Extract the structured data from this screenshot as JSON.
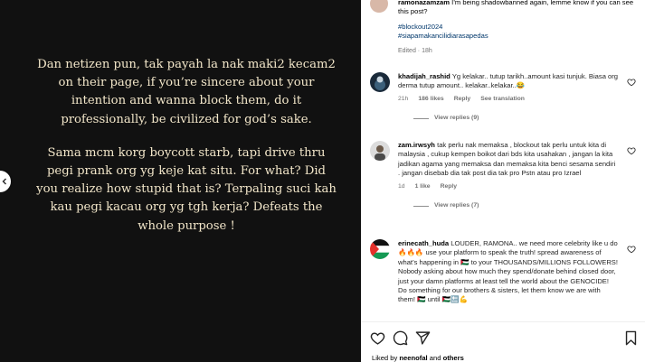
{
  "story": {
    "paragraph1": "Dan netizen pun, tak payah la nak maki2 kecam2 on their page, if you’re sincere about your intention and wanna block them, do it professionally, be civilized for god’s sake.",
    "paragraph2": "Sama mcm korg boycott starb, tapi drive thru pegi prank org yg keje kat situ. For what? Did you realize how stupid that is? Terpaling suci kah kau pegi kacau org yg tgh kerja? Defeats the whole purpose !"
  },
  "caption": {
    "username": "ramonazamzam",
    "text": "I’m being shadowbanned again, lemme know if you can see this post?",
    "hashtags": [
      "#blockout2024",
      "#siapamakancilidiarasapedas"
    ],
    "edited": "Edited · 18h"
  },
  "comments": [
    {
      "username": "khadijah_rashid",
      "text": "Yg kelakar.. tutup tarikh..amount kasi tunjuk. Biasa org derma tutup amount.. kelakar..kelakar..😂",
      "time": "21h",
      "likes": "186 likes",
      "reply": "Reply",
      "translation": "See translation",
      "view_replies": "View replies (9)"
    },
    {
      "username": "zam.irwsyh",
      "text": "tak perlu nak memaksa , blockout tak perlu untuk kita di malaysia , cukup kempen boikot dari bds kita usahakan , jangan la kita jadikan agama yang memaksa dan memaksa kita benci sesama sendiri . jangan disebab dia tak post dia tak pro Pstn atau pro Izrael",
      "time": "1d",
      "likes": "1 like",
      "reply": "Reply",
      "view_replies": "View replies (7)"
    },
    {
      "username": "erinecath_huda",
      "text": "LOUDER, RAMONA.. we need more celebrity like u do🔥🔥🔥 use your platform to speak the truth! spread awareness of what’s happening in 🇵🇸 to your THOUSANDS/MILLIONS FOLLOWERS! Nobody asking about how much they spend/donate behind closed door, just your damn platforms at least tell the world about the GENOCIDE! Do something for our brothers & sisters, let them know we are with them! 🇵🇸 until 🇵🇸🔚💪"
    }
  ],
  "likes": {
    "prefix": "Liked by",
    "user": "neenofal",
    "connector": "and",
    "others": "others"
  },
  "icons": {
    "heart": "heart-icon",
    "comment": "comment-icon",
    "share": "share-icon",
    "save": "bookmark-icon",
    "prev": "chevron-left-icon"
  }
}
